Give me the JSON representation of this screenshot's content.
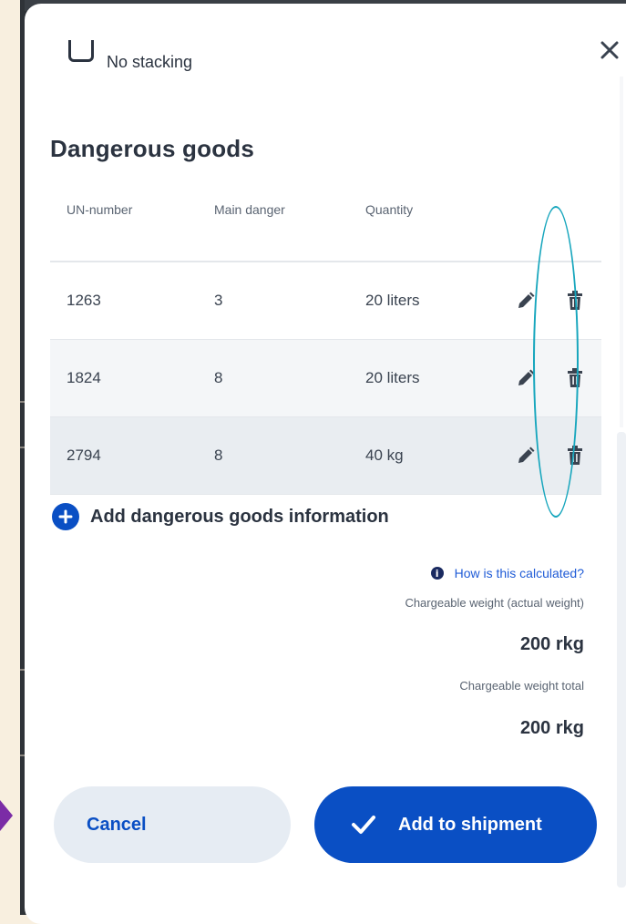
{
  "background_partial": {
    "checkbox_label": "No stacking"
  },
  "section": {
    "title": "Dangerous goods"
  },
  "table": {
    "headers": [
      "UN-number",
      "Main danger",
      "Quantity"
    ],
    "rows": [
      {
        "un_number": "1263",
        "main_danger": "3",
        "quantity": "20 liters",
        "bg": "#ffffff"
      },
      {
        "un_number": "1824",
        "main_danger": "8",
        "quantity": "20 liters",
        "bg": "#f4f6f8"
      },
      {
        "un_number": "2794",
        "main_danger": "8",
        "quantity": "40 kg",
        "bg": "#e9edf1"
      }
    ],
    "row_actions": {
      "edit_icon": "pencil-icon",
      "delete_icon": "trash-icon"
    }
  },
  "add_dangerous_goods": {
    "label": "Add dangerous goods information",
    "icon": "plus-icon"
  },
  "calculation": {
    "link_label": "How is this calculated?",
    "chargeable_weight_label": "Chargeable weight (actual weight)",
    "chargeable_weight_value": "200 rkg",
    "chargeable_total_label": "Chargeable weight total",
    "chargeable_total_value": "200 rkg"
  },
  "footer": {
    "cancel_label": "Cancel",
    "add_label": "Add to shipment",
    "add_icon": "checkmark-icon"
  },
  "colors": {
    "primary": "#0a4fc4",
    "text": "#2b3340",
    "annotation": "#17a6bd"
  }
}
